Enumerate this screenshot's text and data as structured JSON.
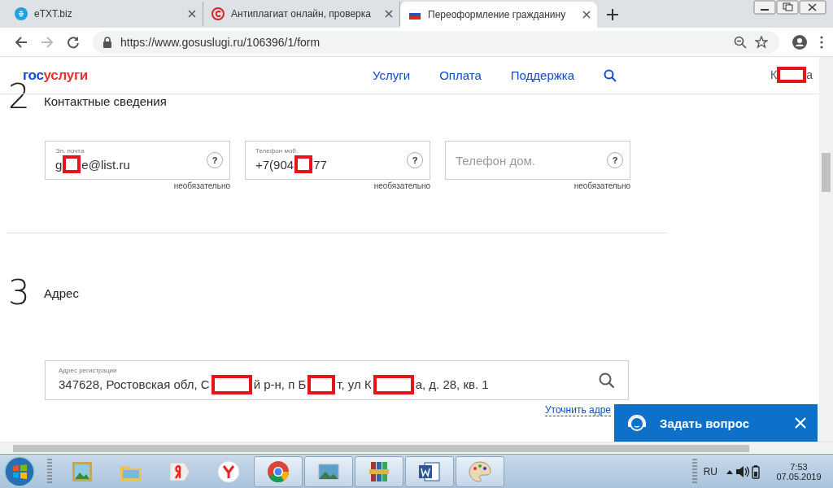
{
  "browser": {
    "tabs": [
      {
        "title": "eTXT.biz",
        "selected": false
      },
      {
        "title": "Антиплагиат онлайн, проверка",
        "selected": false
      },
      {
        "title": "Переоформление гражданину",
        "selected": true
      }
    ],
    "url": "https://www.gosuslugi.ru/106396/1/form"
  },
  "site": {
    "logo_part_1": "гос",
    "logo_part_2": "услуги",
    "nav": [
      "Услуги",
      "Оплата",
      "Поддержка"
    ],
    "user": [
      {
        "kind": "text",
        "text": "К"
      },
      {
        "kind": "redacted"
      },
      {
        "kind": "text",
        "text": "а"
      }
    ]
  },
  "sections": [
    {
      "number": "2",
      "title": "Контактные сведения",
      "fields": [
        {
          "label": "Эл. почта",
          "value": [
            {
              "kind": "text",
              "text": "g"
            },
            {
              "kind": "redacted"
            },
            {
              "kind": "text",
              "text": "e@list.ru"
            }
          ],
          "help": "?",
          "hint": "необязательно"
        },
        {
          "label": "Телефон моб.",
          "value": [
            {
              "kind": "text",
              "text": "+7(904"
            },
            {
              "kind": "redacted"
            },
            {
              "kind": "text",
              "text": "77"
            }
          ],
          "help": "?",
          "hint": "необязательно"
        },
        {
          "placeholder": "Телефон дом.",
          "help": "?",
          "hint": "необязательно"
        }
      ]
    },
    {
      "number": "3",
      "title": "Адрес",
      "address": {
        "label": "Адрес регистрации",
        "value": [
          {
            "kind": "text",
            "text": "347628, Ростовская обл, С"
          },
          {
            "kind": "redacted"
          },
          {
            "kind": "text",
            "text": "й р-н, п Б"
          },
          {
            "kind": "redacted"
          },
          {
            "kind": "text",
            "text": "т, ул К"
          },
          {
            "kind": "redacted"
          },
          {
            "kind": "text",
            "text": "а, д. 28, кв. 1"
          }
        ],
        "link": "Уточнить адре"
      }
    }
  ],
  "chat_widget": {
    "label": "Задать вопрос"
  },
  "taskbar": {
    "language": "RU",
    "time": "7:53",
    "date": "07.05.2019"
  }
}
